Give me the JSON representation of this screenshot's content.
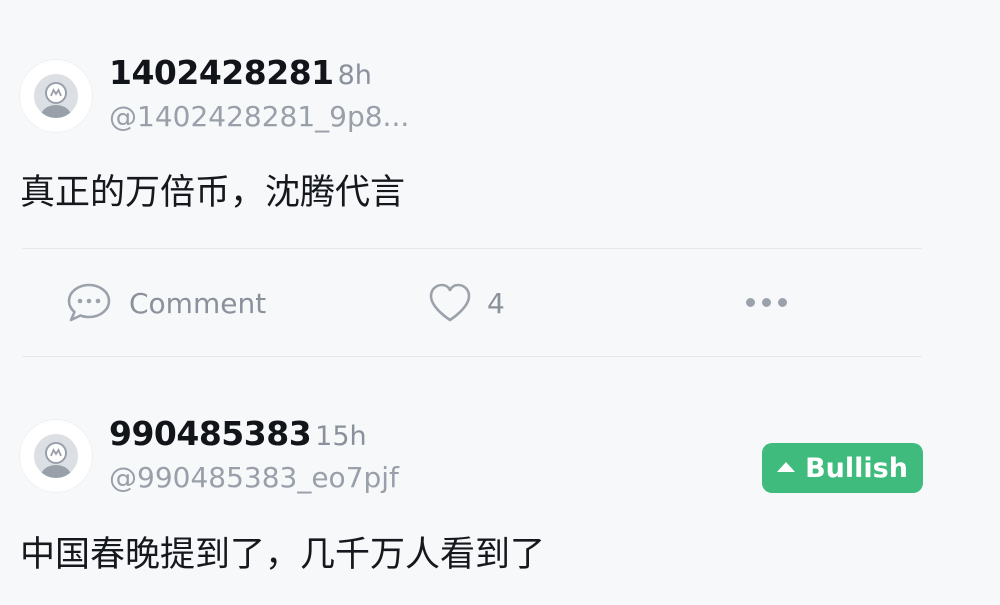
{
  "posts": [
    {
      "username": "1402428281",
      "time": "8h",
      "handle": "@1402428281_9p8...",
      "content": "真正的万倍币，沈腾代言",
      "actions": {
        "comment_label": "Comment",
        "like_count": "4"
      }
    },
    {
      "username": "990485383",
      "time": "15h",
      "handle": "@990485383_eo7pjf",
      "content": "中国春晚提到了，几千万人看到了",
      "sentiment_label": "Bullish"
    }
  ],
  "icons": {
    "avatar": "default-avatar-icon",
    "comment": "comment-bubble-icon",
    "like": "heart-icon",
    "more": "more-dots-icon",
    "bullish": "triangle-up-icon"
  },
  "colors": {
    "background": "#f7f8fa",
    "bullish": "#3fbc7d",
    "muted_text": "#8b919b"
  }
}
